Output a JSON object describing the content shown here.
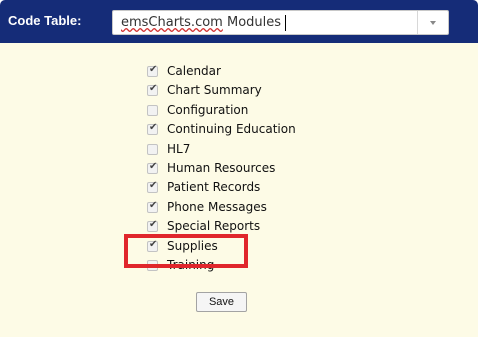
{
  "header": {
    "label": "Code Table:",
    "select_value_underlined": "emsCharts.com",
    "select_value_rest": " Modules"
  },
  "modules": [
    {
      "label": "Calendar",
      "checked": true
    },
    {
      "label": "Chart Summary",
      "checked": true
    },
    {
      "label": "Configuration",
      "checked": false
    },
    {
      "label": "Continuing Education",
      "checked": true
    },
    {
      "label": "HL7",
      "checked": false
    },
    {
      "label": "Human Resources",
      "checked": true
    },
    {
      "label": "Patient Records",
      "checked": true
    },
    {
      "label": "Phone Messages",
      "checked": true
    },
    {
      "label": "Special Reports",
      "checked": true
    },
    {
      "label": "Supplies",
      "checked": true
    },
    {
      "label": "Training",
      "checked": false
    }
  ],
  "save_label": "Save",
  "colors": {
    "header_bg": "#152c78",
    "panel_bg": "#fdfbe6",
    "highlight": "#e0262c"
  }
}
